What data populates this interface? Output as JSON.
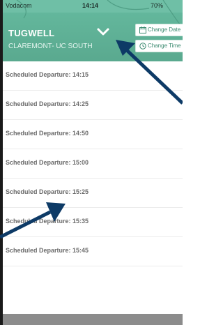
{
  "status_bar": {
    "carrier": "Vodacom",
    "time": "14:14",
    "battery": "70%"
  },
  "header": {
    "title": "TUGWELL",
    "subtitle": "CLAREMONT- UC SOUTH",
    "change_date_label": "Change Date",
    "change_time_label": "Change Time"
  },
  "departures": [
    "Scheduled Departure: 14:15",
    "Scheduled Departure: 14:25",
    "Scheduled Departure: 14:50",
    "Scheduled Departure: 15:00",
    "Scheduled Departure: 15:25",
    "Scheduled Departure: 15:35",
    "Scheduled Departure: 15:45"
  ],
  "colors": {
    "header": "#5fb197",
    "accent": "#3a8a6f",
    "arrow": "#0d3a66"
  }
}
